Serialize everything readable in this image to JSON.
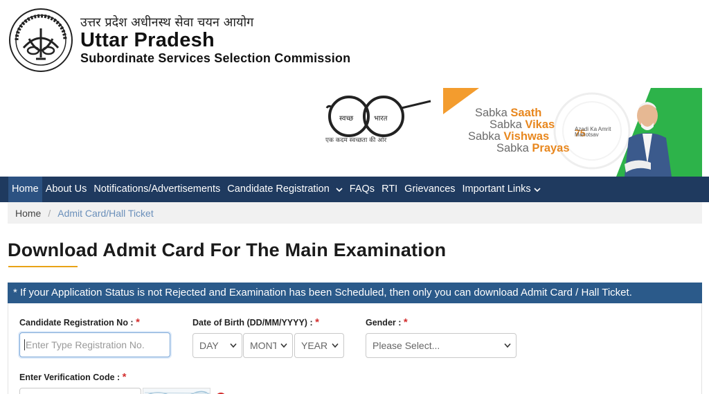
{
  "header": {
    "org_hindi": "उत्तर प्रदेश अधीनस्थ सेवा चयन आयोग",
    "org_title": "Uttar Pradesh",
    "org_subtitle": "Subordinate Services Selection Commission",
    "emblem_icon": "up-government-emblem-icon",
    "swachh_left": "स्वच्छ",
    "swachh_right": "भारत",
    "swachh_caption": "एक कदम स्वच्छता की ओर",
    "banner": {
      "line1_a": "Sabka",
      "line1_b": "Saath",
      "line2_a": "Sabka",
      "line2_b": "Vikas",
      "line3_a": "Sabka",
      "line3_b": "Vishwas",
      "line4_a": "Sabka",
      "line4_b": "Prayas",
      "azadi": "Azadi Ka Amrit Mahotsav",
      "azadi_num": "75"
    }
  },
  "nav": {
    "items": [
      {
        "label": "Home"
      },
      {
        "label": "About Us"
      },
      {
        "label": "Notifications/Advertisements"
      },
      {
        "label": "Candidate Registration"
      },
      {
        "label": "FAQs"
      },
      {
        "label": "RTI"
      },
      {
        "label": "Grievances"
      },
      {
        "label": "Important Links"
      }
    ]
  },
  "breadcrumb": {
    "home": "Home",
    "separator": "/",
    "current": "Admit Card/Hall Ticket"
  },
  "page": {
    "title": "Download Admit Card For The Main Examination",
    "notice": "* If your Application Status is not Rejected and Examination has been Scheduled, then only you can download Admit Card / Hall Ticket."
  },
  "form": {
    "reg_label": "Candidate Registration No :",
    "reg_placeholder": "Enter Type Registration No.",
    "dob_label": "Date of Birth (DD/MM/YYYY) :",
    "day": "DAY",
    "month": "MONTH",
    "year": "YEAR",
    "gender_label": "Gender :",
    "gender_value": "Please Select...",
    "captcha_label": "Enter Verification Code :",
    "required_mark": "*"
  },
  "colors": {
    "nav_bg": "#1f3a5f",
    "notice_bg": "#2b5a8a",
    "accent": "#e8a317",
    "required": "#d32f2f"
  }
}
